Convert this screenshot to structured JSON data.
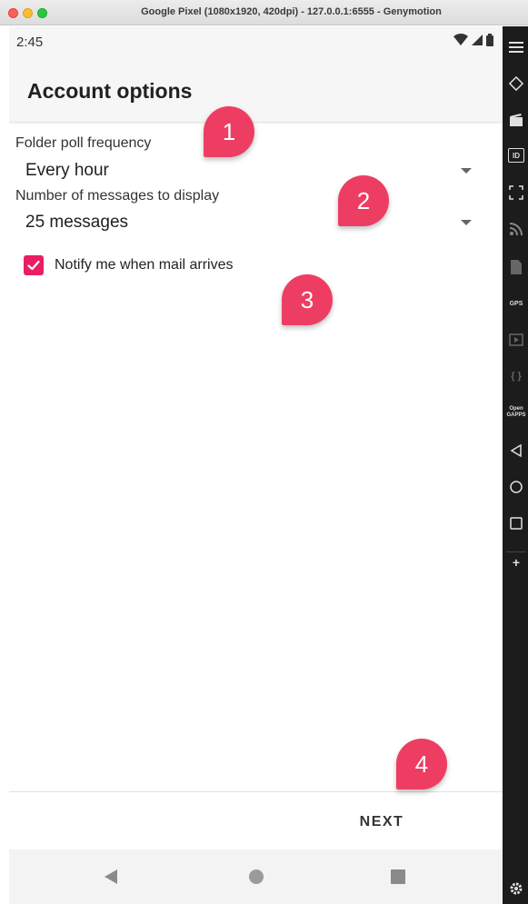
{
  "window": {
    "title": "Google Pixel (1080x1920, 420dpi) - 127.0.0.1:6555 - Genymotion"
  },
  "status_bar": {
    "time": "2:45"
  },
  "app_bar": {
    "title": "Account options"
  },
  "form": {
    "poll_frequency": {
      "label": "Folder poll frequency",
      "value": "Every hour"
    },
    "messages_display": {
      "label": "Number of messages to display",
      "value": "25 messages"
    },
    "notify": {
      "label": "Notify me when mail arrives",
      "checked": true
    }
  },
  "actions": {
    "next_label": "NEXT"
  },
  "annotations": [
    "1",
    "2",
    "3",
    "4"
  ],
  "toolbar": {
    "id_label": "ID",
    "gps_label": "GPS",
    "opengapps_label": "Open GAPPS",
    "code_label": "{ }",
    "add_label": "+"
  },
  "colors": {
    "accent": "#e91e63",
    "callout": "#ee3d62",
    "toolbar_bg": "#1c1c1c"
  }
}
